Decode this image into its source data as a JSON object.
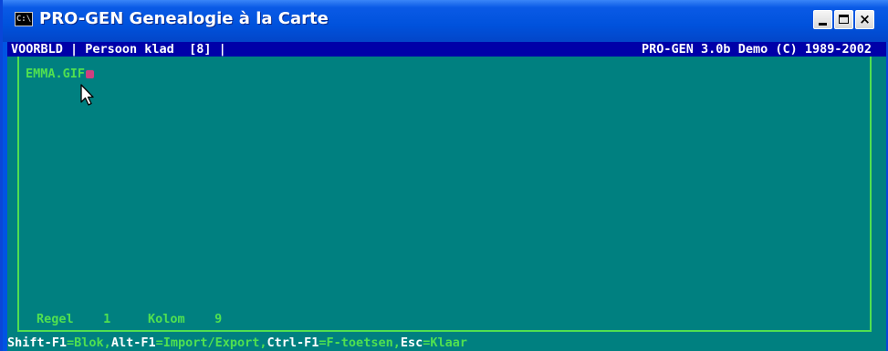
{
  "window": {
    "title": "PRO-GEN Genealogie à la Carte",
    "icon_label": "C:\\",
    "icon": "console-icon",
    "controls": {
      "minimize": "minimize-icon",
      "maximize": "maximize-icon",
      "close": "×"
    }
  },
  "status": {
    "left": "VOORBLD | Persoon klad  [8] |",
    "right": "PRO-GEN 3.0b Demo (C) 1989-2002"
  },
  "editor": {
    "text": "EMMA.GIF"
  },
  "position": {
    "regel_label": "Regel",
    "regel_value": "1",
    "kolom_label": "Kolom",
    "kolom_value": "9"
  },
  "keys": [
    {
      "key": "Shift-F1",
      "desc": "=Blok,"
    },
    {
      "key": "Alt-F1",
      "desc": "=Import/Export,"
    },
    {
      "key": "Ctrl-F1",
      "desc": "=F-toetsen,"
    },
    {
      "key": "Esc",
      "desc": "=Klaar"
    }
  ],
  "colors": {
    "title_blue": "#0054e3",
    "console_teal": "#008080",
    "status_bar": "#0000a8",
    "text_green": "#50e050",
    "key_white": "#ffffff",
    "cursor_pink": "#d04080"
  }
}
